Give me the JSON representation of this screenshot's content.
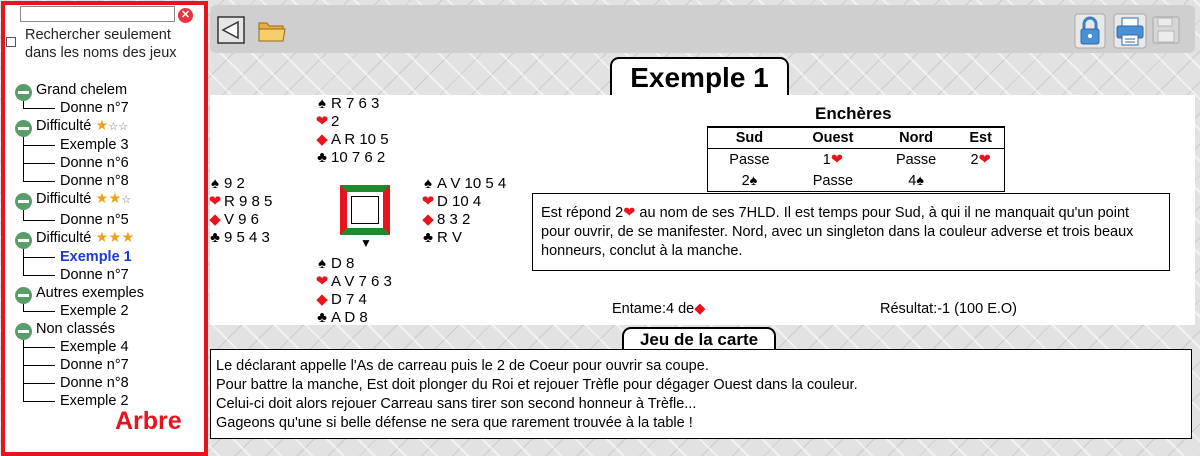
{
  "search": {
    "value": "",
    "placeholder": "",
    "clear_glyph": "✕",
    "only_names_label": "Rechercher seulement dans les noms des jeux"
  },
  "tree": {
    "label": "Arbre",
    "groups": [
      {
        "label": "Grand chelem",
        "stars": [],
        "items": [
          "Donne n°7"
        ]
      },
      {
        "label": "Difficulté",
        "stars": [
          "full",
          "empty",
          "empty"
        ],
        "items": [
          "Exemple 3",
          "Donne n°6",
          "Donne n°8"
        ]
      },
      {
        "label": "Difficulté",
        "stars": [
          "full",
          "full",
          "empty"
        ],
        "items": [
          "Donne n°5"
        ]
      },
      {
        "label": "Difficulté",
        "stars": [
          "full",
          "full",
          "full"
        ],
        "items": [
          "Exemple 1",
          "Donne n°7"
        ]
      },
      {
        "label": "Autres exemples",
        "stars": [],
        "items": [
          "Exemple 2"
        ]
      },
      {
        "label": "Non classés",
        "stars": [],
        "items": [
          "Exemple 4",
          "Donne n°7",
          "Donne n°8",
          "Exemple 2"
        ]
      }
    ],
    "active_item": "Exemple 1"
  },
  "toolbar": {
    "back_icon": "back-triangle-icon",
    "open_icon": "folder-icon",
    "lock_icon": "lock-icon",
    "print_icon": "printer-icon",
    "save_icon": "save-icon"
  },
  "title": "Exemple 1",
  "hands": {
    "north": {
      "spades": "R 7 6 3",
      "hearts": "2",
      "diamonds": "A R 10 5",
      "clubs": "10 7 6 2"
    },
    "west": {
      "spades": "9 2",
      "hearts": "R 9 8 5",
      "diamonds": "V 9 6",
      "clubs": "9 5 4 3"
    },
    "east": {
      "spades": "A V 10 5 4",
      "hearts": "D 10 4",
      "diamonds": "8 3 2",
      "clubs": "R V"
    },
    "south": {
      "spades": "D 8",
      "hearts": "A V 7 6 3",
      "diamonds": "D 7 4",
      "clubs": "A D 8"
    }
  },
  "suits": {
    "spades": "♠",
    "hearts": "❤",
    "diamonds": "◆",
    "clubs": "♣"
  },
  "colors": {
    "red": "#e8141d",
    "green": "#1c8a2d",
    "tree_border": "#e8141d",
    "active_link": "#1a3ccf",
    "toggle": "#5b9d6a",
    "star": "#f2a21a"
  },
  "bidding": {
    "title": "Enchères",
    "headers": [
      "Sud",
      "Ouest",
      "Nord",
      "Est"
    ],
    "rows": [
      [
        {
          "text": "Passe"
        },
        {
          "text": "1",
          "suit": "hearts"
        },
        {
          "text": "Passe"
        },
        {
          "text": "2",
          "suit": "hearts"
        }
      ],
      [
        {
          "text": "2",
          "suit": "spades"
        },
        {
          "text": "Passe"
        },
        {
          "text": "4",
          "suit": "spades"
        },
        {
          "text": ""
        }
      ]
    ]
  },
  "comment": {
    "before_suit": "Est répond 2",
    "after_suit": " au nom de ses 7HLD. Il est temps pour Sud, à qui il ne manquait qu'un point pour ouvrir, de se manifester. Nord, avec un singleton dans la couleur adverse et trois beaux honneurs, conclut à la manche."
  },
  "lead": {
    "label": "Entame:4 de"
  },
  "result": "Résultat:-1 (100 E.O)",
  "play": {
    "title": "Jeu de la carte",
    "lines": [
      "Le déclarant appelle l'As de carreau puis le 2 de Coeur pour ouvrir sa coupe.",
      "Pour battre la manche, Est doit plonger du Roi et rejouer Trèfle pour dégager Ouest dans la couleur.",
      "Celui-ci doit alors rejouer Carreau sans tirer son second honneur à Trèfle...",
      "Gageons qu'une si belle défense ne sera que rarement trouvée à la table !"
    ]
  }
}
